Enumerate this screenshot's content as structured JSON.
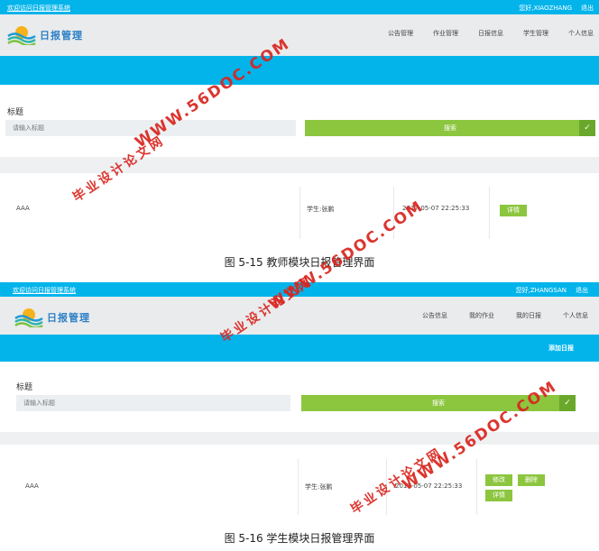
{
  "screenshot1": {
    "topbar": {
      "welcome": "欢迎访问日报管理系统",
      "hello": "您好,XIAOZHANG",
      "logout": "退出"
    },
    "brand": "日报管理",
    "nav": [
      "公告管理",
      "作业管理",
      "日报信息",
      "学生管理",
      "个人信息"
    ],
    "search": {
      "label": "标题",
      "placeholder": "请输入标题",
      "button": "搜索"
    },
    "row": {
      "title": "AAA",
      "student": "学生:张鹏",
      "time": "2017-05-07 22:25:33",
      "detail": "详情"
    }
  },
  "caption1": "图 5-15 教师模块日报管理界面",
  "screenshot2": {
    "topbar": {
      "welcome": "欢迎访问日报管理系统",
      "hello": "您好,ZHANGSAN",
      "logout": "退出"
    },
    "brand": "日报管理",
    "nav": [
      "公告信息",
      "我的作业",
      "我的日报",
      "个人信息"
    ],
    "add_button": "添加日报",
    "search": {
      "label": "标题",
      "placeholder": "请输入标题",
      "button": "搜索"
    },
    "row": {
      "title": "AAA",
      "student": "学生:张鹏",
      "time": "2017-05-07 22:25:33",
      "edit": "修改",
      "delete": "删除",
      "detail": "详情"
    }
  },
  "caption2": "图 5-16 学生模块日报管理界面",
  "watermarks": {
    "url": "WWW.56DOC.COM",
    "cn": "毕业设计论文网"
  },
  "colors": {
    "topbar": "#03b4eb",
    "button_green": "#8cc63f",
    "watermark_red": "#d9251f"
  },
  "icons": {
    "search_submit": "check-icon",
    "logo": "sun-wave-logo-icon"
  }
}
